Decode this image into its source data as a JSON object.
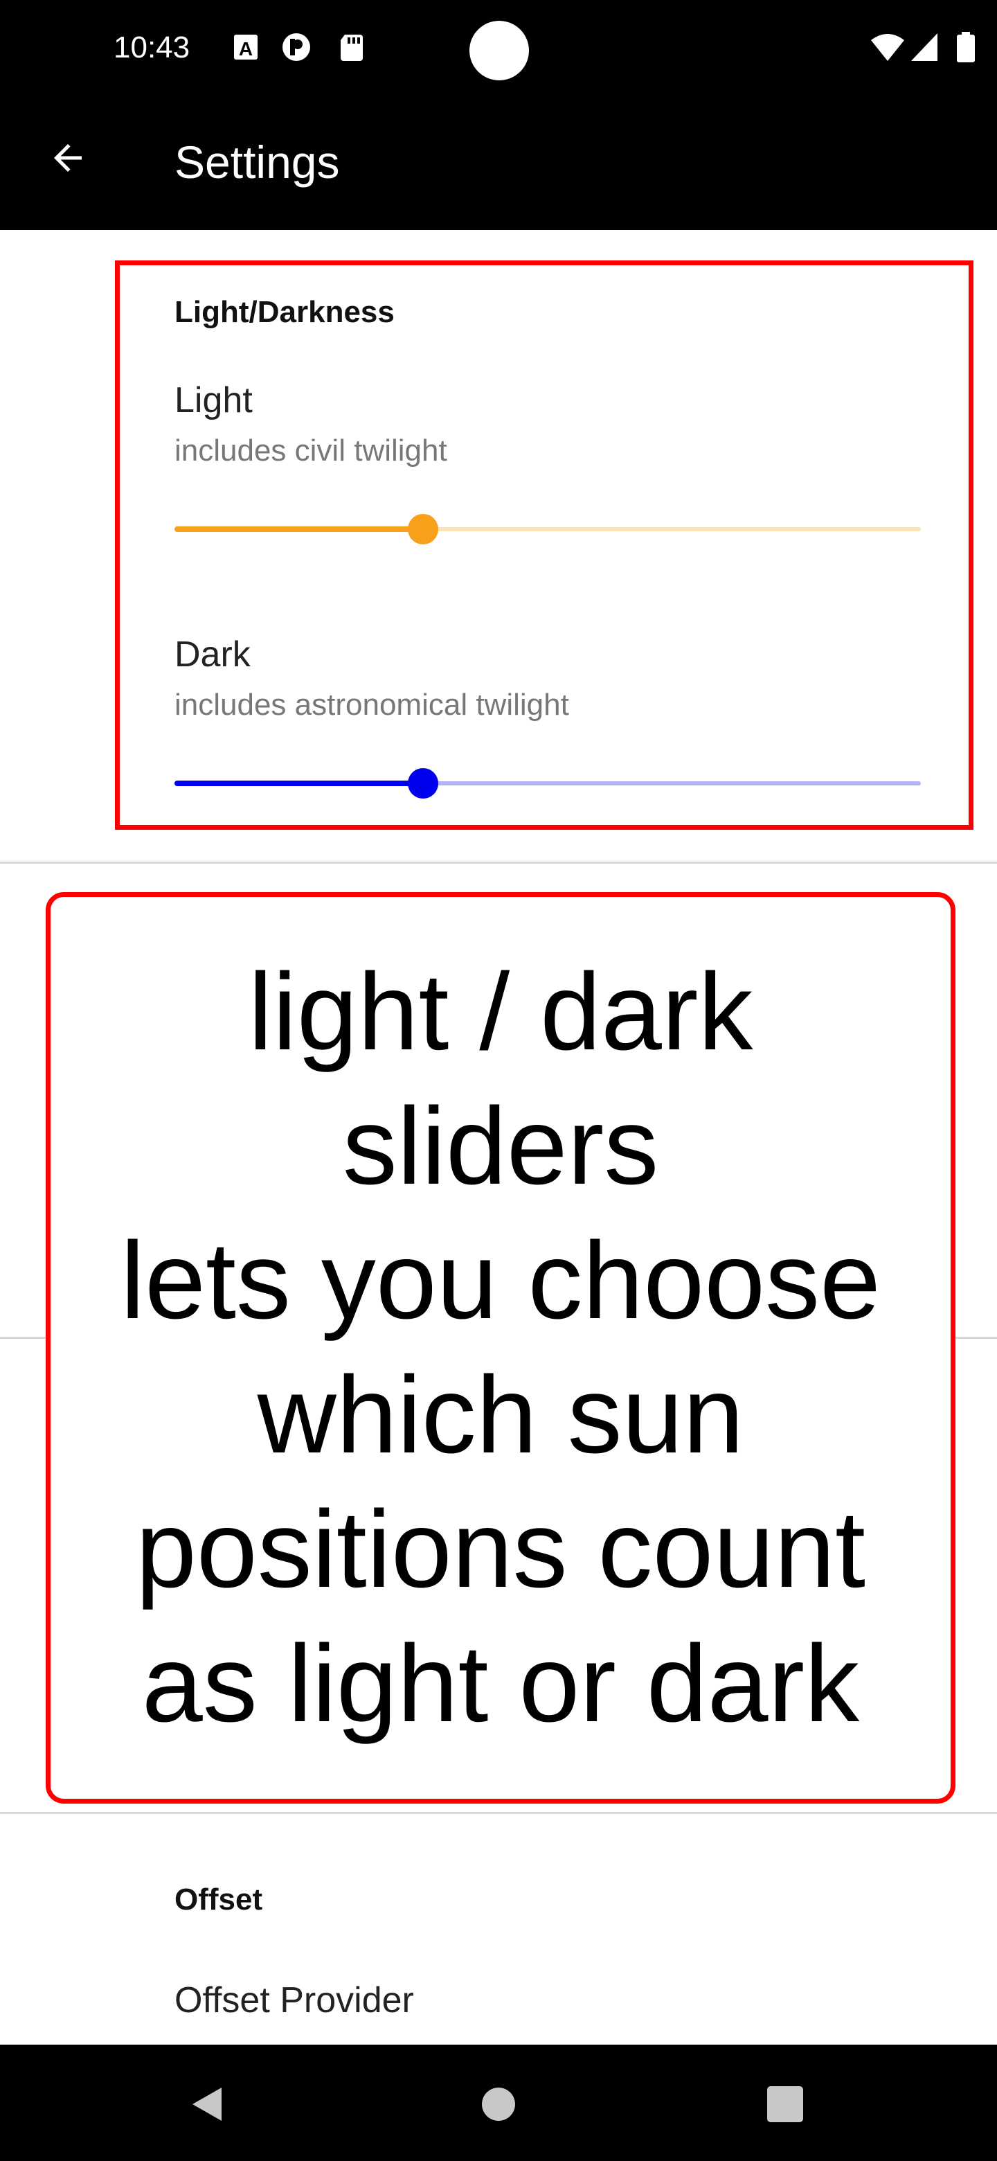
{
  "status_bar": {
    "time": "10:43",
    "left_icons": [
      "a-box-icon",
      "p-circle-icon",
      "sd-card-icon"
    ],
    "right_icons": [
      "wifi-icon",
      "signal-icon",
      "battery-icon"
    ]
  },
  "app_bar": {
    "title": "Settings",
    "back_icon": "arrow-back-icon"
  },
  "light_darkness": {
    "section_title": "Light/Darkness",
    "light": {
      "title": "Light",
      "summary": "includes civil twilight",
      "value_fraction": 0.333,
      "color": "#f9a01b",
      "inactive_color": "#fde3b8"
    },
    "dark": {
      "title": "Dark",
      "summary": "includes astronomical twilight",
      "value_fraction": 0.333,
      "color": "#0000ee",
      "inactive_color": "#b3b3f5"
    }
  },
  "callout": {
    "lines": [
      "light / dark",
      "sliders",
      "lets you choose",
      "which sun",
      "positions count",
      "as light or dark"
    ],
    "border_color": "#ff0000"
  },
  "offset": {
    "section_title": "Offset",
    "provider_title": "Offset Provider"
  },
  "nav_bar": {
    "icons": [
      "back-triangle-icon",
      "home-circle-icon",
      "recents-square-icon"
    ]
  }
}
